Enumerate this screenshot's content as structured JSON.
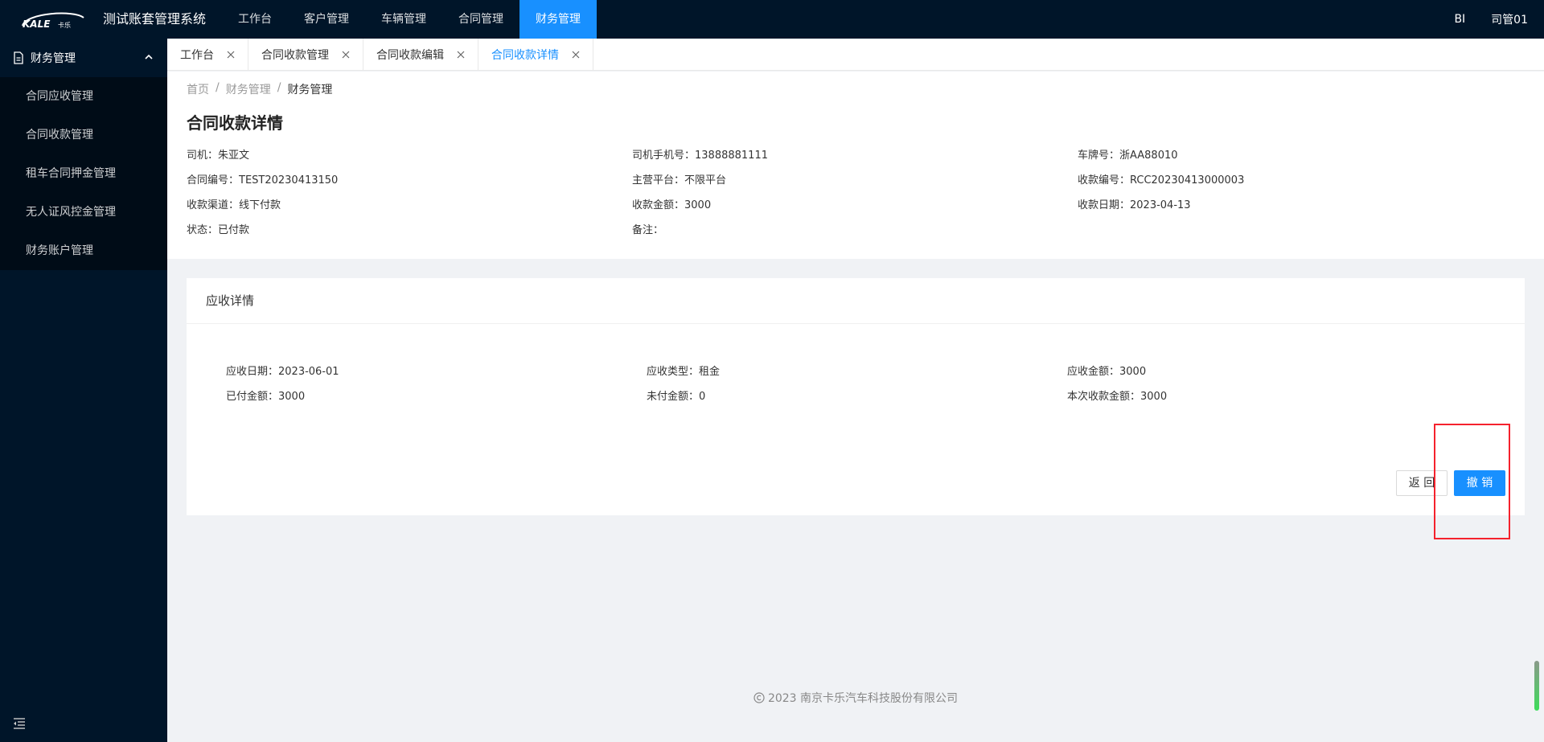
{
  "app": {
    "title": "测试账套管理系统",
    "logo_text": "KALE卡乐"
  },
  "topnav": [
    {
      "label": "工作台"
    },
    {
      "label": "客户管理"
    },
    {
      "label": "车辆管理"
    },
    {
      "label": "合同管理"
    },
    {
      "label": "财务管理",
      "active": true
    }
  ],
  "topright": {
    "bi": "BI",
    "user": "司管01"
  },
  "sidebar": {
    "group_label": "财务管理",
    "items": [
      {
        "label": "合同应收管理"
      },
      {
        "label": "合同收款管理"
      },
      {
        "label": "租车合同押金管理"
      },
      {
        "label": "无人证风控金管理"
      },
      {
        "label": "财务账户管理"
      }
    ]
  },
  "tabs": [
    {
      "label": "工作台"
    },
    {
      "label": "合同收款管理"
    },
    {
      "label": "合同收款编辑"
    },
    {
      "label": "合同收款详情",
      "active": true
    }
  ],
  "breadcrumb": [
    "首页",
    "/",
    "财务管理",
    "/",
    "财务管理"
  ],
  "page": {
    "title": "合同收款详情",
    "info": [
      {
        "text": "司机：朱亚文"
      },
      {
        "text": "司机手机号：13888881111"
      },
      {
        "text": "车牌号：浙AA88010"
      },
      {
        "text": "合同编号：TEST20230413150"
      },
      {
        "text": "主营平台：不限平台"
      },
      {
        "text": "收款编号：RCC20230413000003"
      },
      {
        "text": "收款渠道：线下付款"
      },
      {
        "text": "收款金额：3000"
      },
      {
        "text": "收款日期：2023-04-13"
      },
      {
        "text": "状态：已付款"
      },
      {
        "text": "备注："
      },
      {
        "text": ""
      }
    ]
  },
  "receivable": {
    "title": "应收详情",
    "info": [
      {
        "text": "应收日期：2023-06-01"
      },
      {
        "text": "应收类型：租金"
      },
      {
        "text": "应收金额：3000"
      },
      {
        "text": "已付金额：3000"
      },
      {
        "text": "未付金额：0"
      },
      {
        "text": "本次收款金额：3000"
      }
    ],
    "back_label": "返 回",
    "revoke_label": "撤 销"
  },
  "footer": {
    "text": "2023 南京卡乐汽车科技股份有限公司"
  },
  "colors": {
    "nav_bg": "#001529",
    "accent": "#1890ff",
    "highlight": "#f5222d"
  }
}
